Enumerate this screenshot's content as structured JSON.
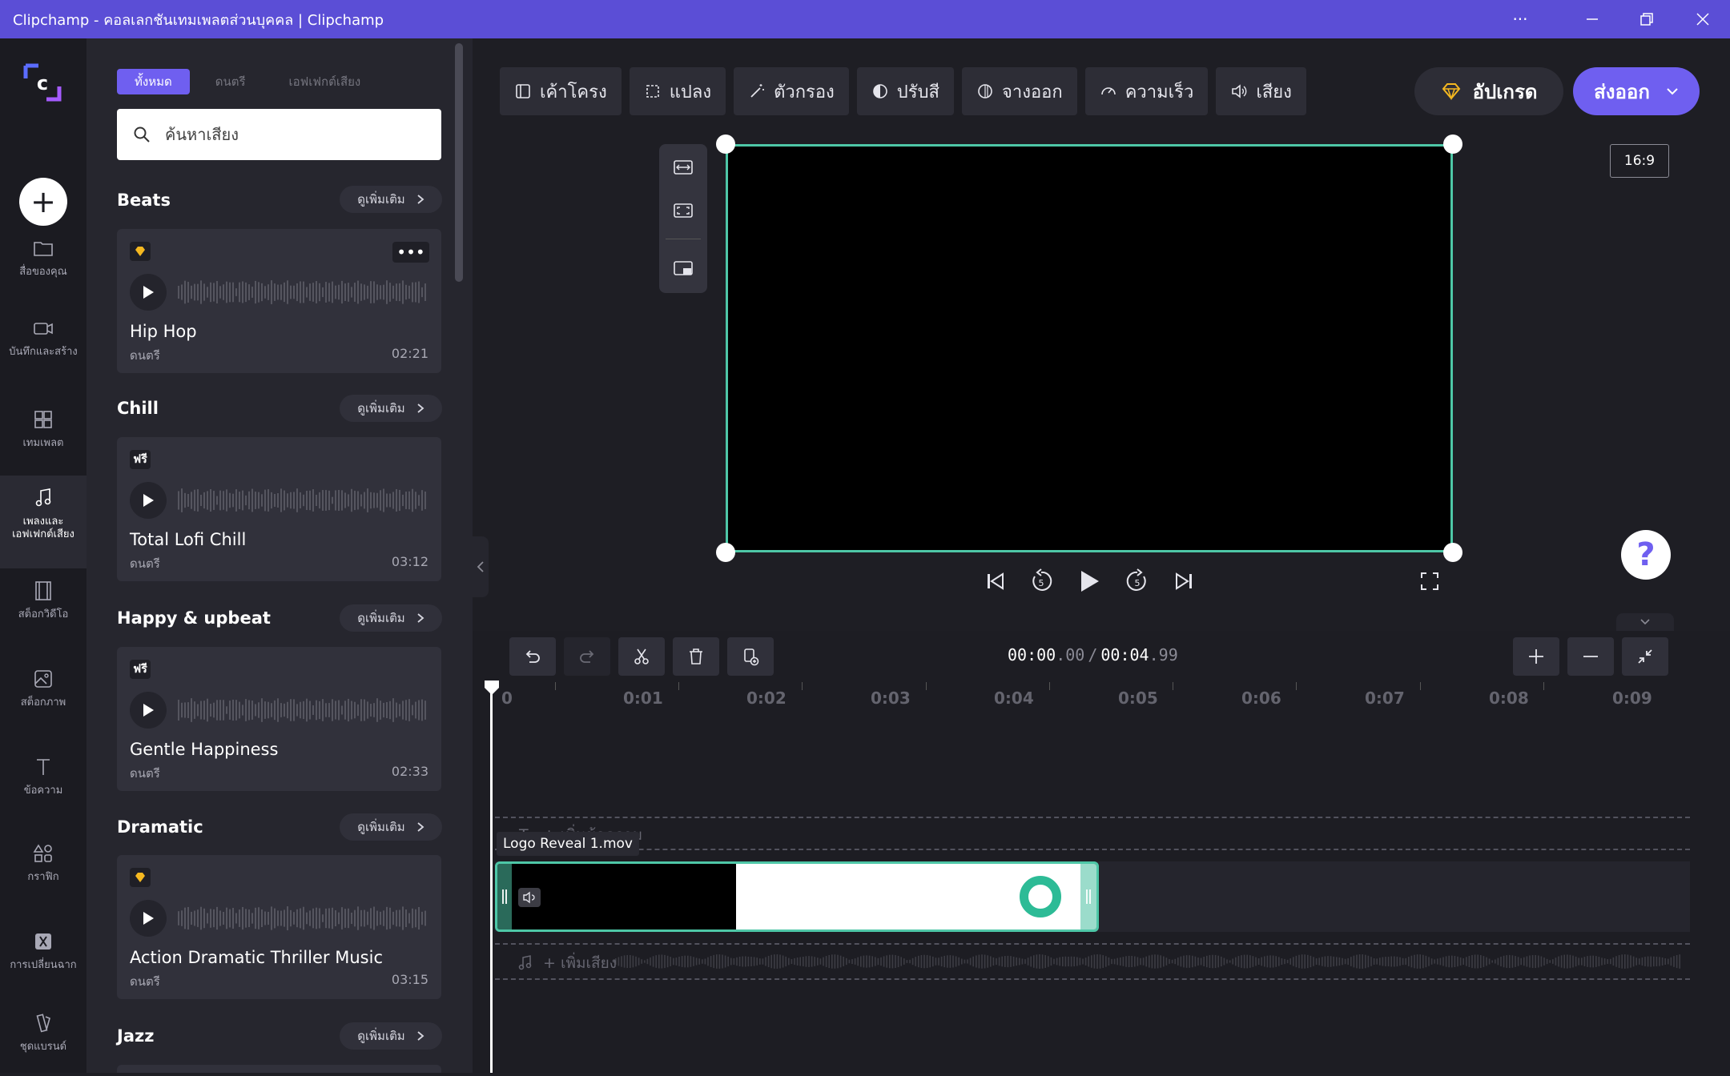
{
  "window": {
    "title": "Clipchamp - คอลเลกชันเทมเพลตส่วนบุคคล | Clipchamp",
    "more_label": "···"
  },
  "leftnav": {
    "items": [
      {
        "label": "สื่อของคุณ",
        "icon": "folder-icon"
      },
      {
        "label": "บันทึกและสร้าง",
        "icon": "camera-icon"
      },
      {
        "label": "เทมเพลต",
        "icon": "template-icon"
      },
      {
        "label": "เพลงและเอฟเฟกต์เสียง",
        "icon": "music-note-icon"
      },
      {
        "label": "สต็อกวิดีโอ",
        "icon": "film-icon"
      },
      {
        "label": "สต็อกภาพ",
        "icon": "image-icon"
      },
      {
        "label": "ข้อความ",
        "icon": "text-icon"
      },
      {
        "label": "กราฟิก",
        "icon": "shapes-icon"
      },
      {
        "label": "การเปลี่ยนฉาก",
        "icon": "transition-icon"
      },
      {
        "label": "ชุดแบรนด์",
        "icon": "brand-kit-icon"
      }
    ],
    "active_index": 3
  },
  "panel": {
    "tabs": [
      "ทั้งหมด",
      "ดนตรี",
      "เอฟเฟกต์เสียง"
    ],
    "active_tab": 0,
    "search_placeholder": "ค้นหาเสียง",
    "see_more_label": "ดูเพิ่มเติม",
    "sections": [
      {
        "title": "Beats",
        "track": {
          "name": "Hip Hop",
          "type": "ดนตรี",
          "duration": "02:21",
          "badge": "premium-gem-icon"
        }
      },
      {
        "title": "Chill",
        "track": {
          "name": "Total Lofi Chill",
          "type": "ดนตรี",
          "duration": "03:12",
          "badge": "ฟรี"
        }
      },
      {
        "title": "Happy & upbeat",
        "track": {
          "name": "Gentle Happiness",
          "type": "ดนตรี",
          "duration": "02:33",
          "badge": "ฟรี"
        }
      },
      {
        "title": "Dramatic",
        "track": {
          "name": "Action Dramatic Thriller Music",
          "type": "ดนตรี",
          "duration": "03:15",
          "badge": "premium-gem-icon"
        }
      },
      {
        "title": "Jazz"
      }
    ]
  },
  "toolbar": {
    "tools": [
      {
        "label": "เค้าโครง",
        "icon": "layout-icon"
      },
      {
        "label": "แปลง",
        "icon": "transform-icon"
      },
      {
        "label": "ตัวกรอง",
        "icon": "magic-wand-icon"
      },
      {
        "label": "ปรับสี",
        "icon": "contrast-icon"
      },
      {
        "label": "จางออก",
        "icon": "fade-icon"
      },
      {
        "label": "ความเร็ว",
        "icon": "speedometer-icon"
      },
      {
        "label": "เสียง",
        "icon": "speaker-icon"
      }
    ],
    "upgrade_label": "อัปเกรด",
    "export_label": "ส่งออก"
  },
  "preview": {
    "aspect_ratio": "16:9",
    "help_label": "?"
  },
  "timeline": {
    "time_current": "00:00",
    "time_current_frac": ".00",
    "time_separator": "/",
    "time_total": "00:04",
    "time_total_frac": ".99",
    "ruler": [
      "0",
      "0:01",
      "0:02",
      "0:03",
      "0:04",
      "0:05",
      "0:06",
      "0:07",
      "0:08",
      "0:09"
    ],
    "add_text_label": "+ เพิ่มข้อความ",
    "clip_name": "Logo Reveal 1.mov",
    "add_audio_label": "+ เพิ่มเสียง"
  },
  "colors": {
    "accent": "#6f5ff0",
    "titlebar": "#5b4ed6",
    "selection": "#4ec7a7"
  }
}
